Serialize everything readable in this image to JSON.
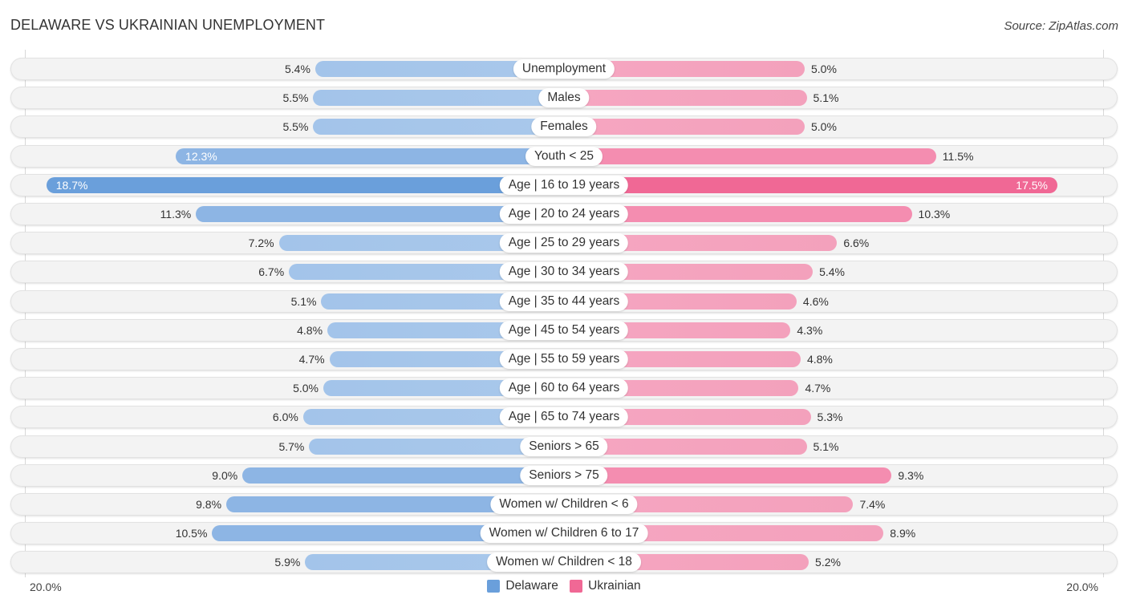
{
  "header": {
    "title": "DELAWARE VS UKRAINIAN UNEMPLOYMENT",
    "source": "Source: ZipAtlas.com"
  },
  "colors": {
    "delaware": "#6a9fdb",
    "ukrainian": "#f06895"
  },
  "chart_data": {
    "type": "bar",
    "orientation": "horizontal-diverging",
    "title": "DELAWARE VS UKRAINIAN UNEMPLOYMENT",
    "unit": "%",
    "xlim": [
      0,
      20
    ],
    "axis_labels": {
      "left": "20.0%",
      "right": "20.0%"
    },
    "legend": [
      "Delaware",
      "Ukrainian"
    ],
    "legend_position": "bottom-center",
    "categories": [
      "Unemployment",
      "Males",
      "Females",
      "Youth < 25",
      "Age | 16 to 19 years",
      "Age | 20 to 24 years",
      "Age | 25 to 29 years",
      "Age | 30 to 34 years",
      "Age | 35 to 44 years",
      "Age | 45 to 54 years",
      "Age | 55 to 59 years",
      "Age | 60 to 64 years",
      "Age | 65 to 74 years",
      "Seniors > 65",
      "Seniors > 75",
      "Women w/ Children < 6",
      "Women w/ Children 6 to 17",
      "Women w/ Children < 18"
    ],
    "series": [
      {
        "name": "Delaware",
        "side": "left",
        "values": [
          5.4,
          5.5,
          5.5,
          12.3,
          18.7,
          11.3,
          7.2,
          6.7,
          5.1,
          4.8,
          4.7,
          5.0,
          6.0,
          5.7,
          9.0,
          9.8,
          10.5,
          5.9
        ],
        "labels": [
          "5.4%",
          "5.5%",
          "5.5%",
          "12.3%",
          "18.7%",
          "11.3%",
          "7.2%",
          "6.7%",
          "5.1%",
          "4.8%",
          "4.7%",
          "5.0%",
          "6.0%",
          "5.7%",
          "9.0%",
          "9.8%",
          "10.5%",
          "5.9%"
        ]
      },
      {
        "name": "Ukrainian",
        "side": "right",
        "values": [
          5.0,
          5.1,
          5.0,
          11.5,
          17.5,
          10.3,
          6.6,
          5.4,
          4.6,
          4.3,
          4.8,
          4.7,
          5.3,
          5.1,
          9.3,
          7.4,
          8.9,
          5.2
        ],
        "labels": [
          "5.0%",
          "5.1%",
          "5.0%",
          "11.5%",
          "17.5%",
          "10.3%",
          "6.6%",
          "5.4%",
          "4.6%",
          "4.3%",
          "4.8%",
          "4.7%",
          "5.3%",
          "5.1%",
          "9.3%",
          "7.4%",
          "8.9%",
          "5.2%"
        ]
      }
    ]
  }
}
